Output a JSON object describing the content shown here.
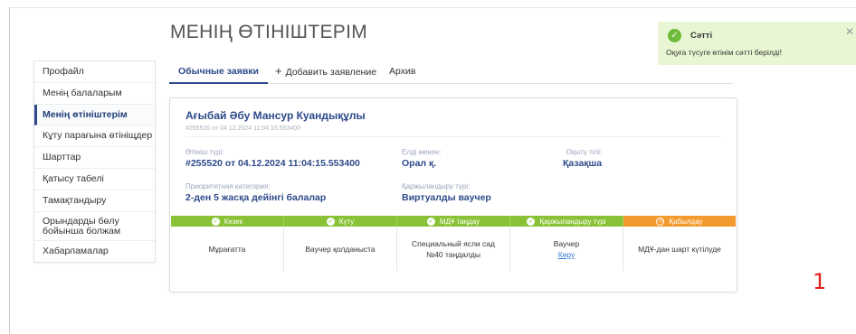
{
  "page": {
    "title": "МЕНІҢ ӨТІНІШТЕРІМ"
  },
  "sidebar": {
    "items": [
      {
        "label": "Профайл"
      },
      {
        "label": "Менің балаларым"
      },
      {
        "label": "Менің өтініштерім",
        "active": true
      },
      {
        "label": "Кұту парағына өтініщдер"
      },
      {
        "label": "Шарттар"
      },
      {
        "label": "Қатысу табелі"
      },
      {
        "label": "Тамақтандыру"
      },
      {
        "label": "Орындарды бөлу бойынша болжам"
      },
      {
        "label": "Хабарламалар"
      }
    ]
  },
  "tabs": [
    {
      "label": "Обычные заявки",
      "active": true
    },
    {
      "label": "Добавить заявление",
      "icon": "plus-icon"
    },
    {
      "label": "Архив"
    }
  ],
  "application": {
    "name": "Ағыбай Әбу Мансур Куандықұлы",
    "subtitle": "#255520 от 04.12.2024 11:04:15.553400",
    "fields": {
      "type_label": "Өтініш түрі:",
      "type_value": "#255520 от 04.12.2024 11:04:15.553400",
      "locality_label": "Елді мекен:",
      "locality_value": "Орал қ.",
      "language_label": "Оқыту тілі:",
      "language_value": "Қазақша",
      "priority_label": "Приоритетная категория:",
      "priority_value": "2-ден 5 жасқа дейінгі балалар",
      "funding_label": "Қаржыландыру түрі:",
      "funding_value": "Виртуалды ваучер"
    },
    "status_steps": [
      {
        "label": "Кезек",
        "state": "done",
        "color": "#89c236"
      },
      {
        "label": "Күту",
        "state": "done",
        "color": "#89c236"
      },
      {
        "label": "МДҰ таңдау",
        "state": "done",
        "color": "#89c236"
      },
      {
        "label": "Қаржыландыру түрі",
        "state": "done",
        "color": "#89c236"
      },
      {
        "label": "Қабылдау",
        "state": "pending",
        "color": "#f39a2e"
      }
    ],
    "status_details": [
      {
        "text": "Мұрағатта"
      },
      {
        "text": "Ваучер қолданыста"
      },
      {
        "text": "Специальный ясли сад №40 таңдалды"
      },
      {
        "text": "Ваучер",
        "link": "Көру"
      },
      {
        "text": "МДҰ-дан шарт күтілуде"
      }
    ]
  },
  "toast": {
    "title": "Сәтті",
    "message": "Оқуға түсуге өтінім сәтті берілді!",
    "icon": "check-circle-icon",
    "close_icon": "close-icon",
    "color": "#e8f6d3"
  },
  "page_number": "1"
}
